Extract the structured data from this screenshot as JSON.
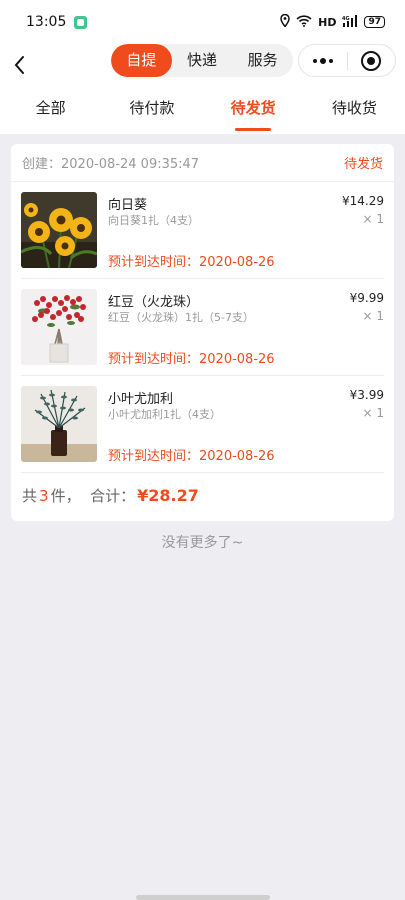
{
  "status_bar": {
    "time": "13:05",
    "network": "HD",
    "signal": "4G",
    "battery": "97"
  },
  "nav": {
    "segments": [
      {
        "label": "自提",
        "active": true
      },
      {
        "label": "快递",
        "active": false
      },
      {
        "label": "服务",
        "active": false
      }
    ]
  },
  "tabs": [
    {
      "label": "全部",
      "active": false
    },
    {
      "label": "待付款",
      "active": false
    },
    {
      "label": "待发货",
      "active": true
    },
    {
      "label": "待收货",
      "active": false
    }
  ],
  "order": {
    "created": "创建：2020-08-24 09:35:47",
    "status": "待发货",
    "items": [
      {
        "name": "向日葵",
        "spec": "向日葵1扎（4支）",
        "price": "¥14.29",
        "qty": "× 1",
        "eta": "预计到达时间：2020-08-26",
        "thumb_icon": "sunflower-image"
      },
      {
        "name": "红豆（火龙珠）",
        "spec": "红豆（火龙珠）1扎（5-7支）",
        "price": "¥9.99",
        "qty": "× 1",
        "eta": "预计到达时间：2020-08-26",
        "thumb_icon": "red-berries-image"
      },
      {
        "name": "小叶尤加利",
        "spec": "小叶尤加利1扎（4支）",
        "price": "¥3.99",
        "qty": "× 1",
        "eta": "预计到达时间：2020-08-26",
        "thumb_icon": "eucalyptus-image"
      }
    ],
    "summary": {
      "prefix": "共",
      "count": "3",
      "suffix": "件，  合计：",
      "total": "¥28.27"
    }
  },
  "footer": {
    "no_more": "没有更多了~"
  },
  "colors": {
    "accent": "#f04b1d",
    "background": "#eeedf2"
  }
}
